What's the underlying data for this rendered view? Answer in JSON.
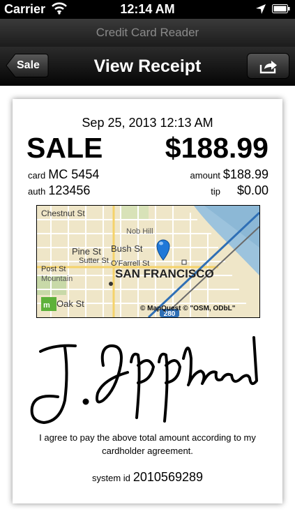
{
  "status_bar": {
    "carrier": "Carrier",
    "time": "12:14 AM"
  },
  "app": {
    "title": "Credit Card Reader"
  },
  "nav": {
    "back_label": "Sale",
    "title": "View Receipt"
  },
  "receipt": {
    "date": "Sep 25, 2013 12:13 AM",
    "type": "SALE",
    "total": "$188.99",
    "card_label": "card",
    "card_value": "MC 5454",
    "auth_label": "auth",
    "auth_value": "123456",
    "amount_label": "amount",
    "amount_value": "$188.99",
    "tip_label": "tip",
    "tip_value": "$0.00",
    "map": {
      "streets": [
        "Chestnut St",
        "Nob Hill",
        "Pine St",
        "Bush St",
        "O'Farrell St",
        "Post St",
        "Sutter St",
        "Mountain",
        "Oak St"
      ],
      "city": "SAN FRANCISCO",
      "route": "280",
      "attribution": "© MapQuest © \"OSM, ODbL\""
    },
    "agreement": "I agree to pay the above total amount according to my cardholder agreement.",
    "system_id_label": "system id",
    "system_id_value": "2010569289"
  },
  "colors": {
    "pin": "#1f78d8",
    "nav_bg": "#111111"
  }
}
